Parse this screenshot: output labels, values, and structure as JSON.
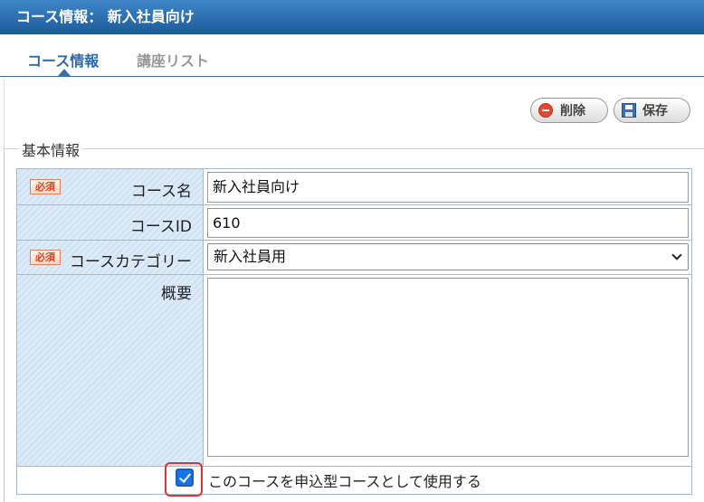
{
  "header": {
    "title": "コース情報： 新入社員向け"
  },
  "tabs": [
    {
      "label": "コース情報",
      "active": true
    },
    {
      "label": "講座リスト",
      "active": false
    }
  ],
  "toolbar": {
    "delete_label": "削除",
    "save_label": "保存"
  },
  "section": {
    "legend": "基本情報"
  },
  "form": {
    "required_badge": "必須",
    "course_name": {
      "label": "コース名",
      "value": "新入社員向け",
      "required": true
    },
    "course_id": {
      "label": "コースID",
      "value": "610"
    },
    "course_category": {
      "label": "コースカテゴリー",
      "value": "新入社員用",
      "required": true
    },
    "summary": {
      "label": "概要",
      "value": ""
    },
    "application_type": {
      "label": "このコースを申込型コースとして使用する",
      "checked": true
    }
  },
  "colors": {
    "header_blue": "#2f6aa8",
    "required_red": "#d2421e",
    "highlight_red": "#e23232"
  }
}
